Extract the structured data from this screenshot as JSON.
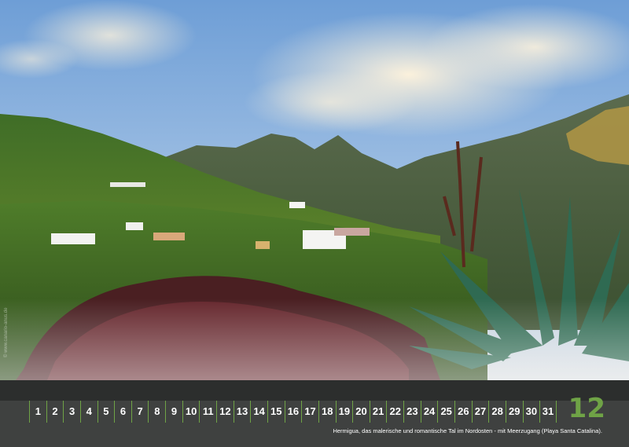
{
  "calendar": {
    "month_number": "12",
    "days": [
      "1",
      "2",
      "3",
      "4",
      "5",
      "6",
      "7",
      "8",
      "9",
      "10",
      "11",
      "12",
      "13",
      "14",
      "15",
      "16",
      "17",
      "18",
      "19",
      "20",
      "21",
      "22",
      "23",
      "24",
      "25",
      "26",
      "27",
      "28",
      "29",
      "30",
      "31"
    ],
    "caption": "Hermigua, das malerische und romantische Tal im Nordosten - mit Meerzugang (Playa Santa Catalina).",
    "photo_credit": "© www.canario-anus.de"
  },
  "colors": {
    "accent_green": "#6fa346",
    "strip_dark": "#2c2e2d",
    "strip_mid": "#3f4140"
  }
}
